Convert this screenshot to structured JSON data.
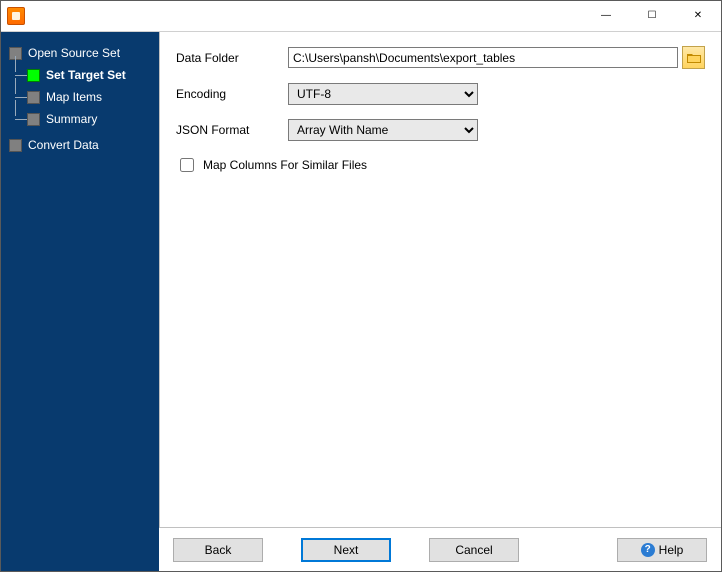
{
  "titlebar": {
    "minimize_glyph": "—",
    "maximize_glyph": "☐",
    "close_glyph": "✕"
  },
  "sidebar": {
    "items": [
      {
        "label": "Open Source Set"
      },
      {
        "label": "Set Target Set"
      },
      {
        "label": "Map Items"
      },
      {
        "label": "Summary"
      },
      {
        "label": "Convert Data"
      }
    ]
  },
  "form": {
    "data_folder_label": "Data Folder",
    "data_folder_value": "C:\\Users\\pansh\\Documents\\export_tables",
    "encoding_label": "Encoding",
    "encoding_value": "UTF-8",
    "json_format_label": "JSON Format",
    "json_format_value": "Array With Name",
    "map_columns_label": "Map Columns For Similar Files",
    "map_columns_checked": false
  },
  "buttons": {
    "back": "Back",
    "next": "Next",
    "cancel": "Cancel",
    "help": "Help"
  }
}
